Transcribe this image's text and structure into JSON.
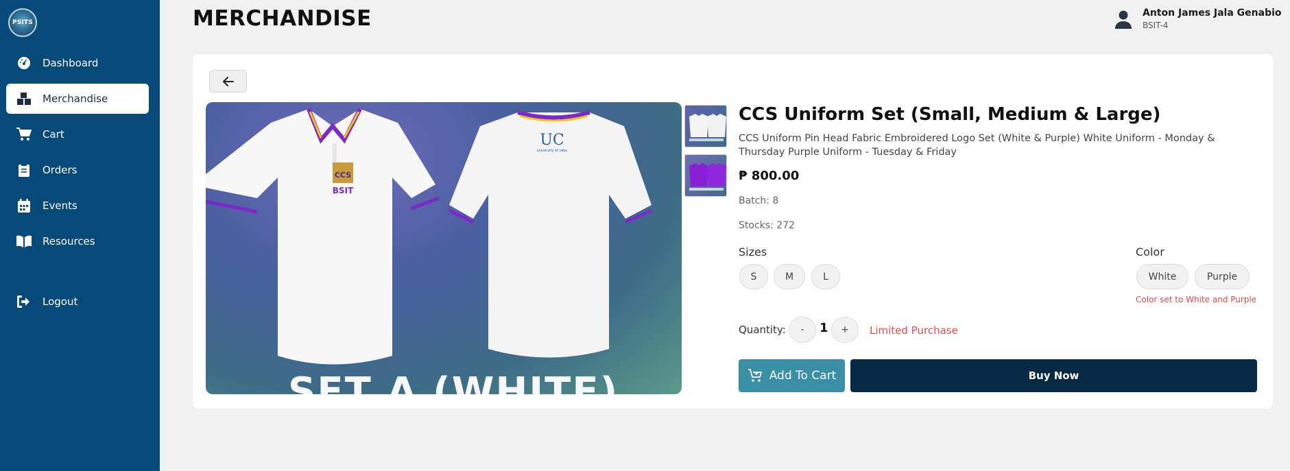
{
  "app": {
    "logo_text": "PSITS"
  },
  "sidebar": {
    "items": [
      {
        "label": "Dashboard",
        "icon": "dashboard-gauge-icon",
        "active": false
      },
      {
        "label": "Merchandise",
        "icon": "boxes-icon",
        "active": true
      },
      {
        "label": "Cart",
        "icon": "cart-icon",
        "active": false
      },
      {
        "label": "Orders",
        "icon": "clipboard-icon",
        "active": false
      },
      {
        "label": "Events",
        "icon": "calendar-icon",
        "active": false
      },
      {
        "label": "Resources",
        "icon": "book-icon",
        "active": false
      },
      {
        "label": "Logout",
        "icon": "logout-icon",
        "active": false
      }
    ]
  },
  "header": {
    "title": "MERCHANDISE",
    "user": {
      "name": "Anton James Jala Genabio",
      "sub": "BSIT-4",
      "icon": "user-icon"
    }
  },
  "product": {
    "image_caption": "SET A (WHITE)",
    "title": "CCS Uniform Set (Small, Medium & Large)",
    "description": "CCS Uniform Pin Head Fabric Embroidered Logo Set (White & Purple) White Uniform - Monday & Thursday Purple Uniform - Tuesday & Friday",
    "price": "₱ 800.00",
    "batch": "Batch: 8",
    "stocks": "Stocks: 272",
    "sizes_label": "Sizes",
    "sizes": [
      "S",
      "M",
      "L"
    ],
    "color_label": "Color",
    "colors": [
      "White",
      "Purple"
    ],
    "color_note": "Color set to White and Purple",
    "quantity_label": "Quantity:",
    "quantity": "1",
    "minus": "-",
    "plus": "+",
    "limited": "Limited Purchase",
    "add_to_cart": "Add To Cart",
    "buy_now": "Buy Now"
  },
  "colors": {
    "sidebar": "#074979",
    "add_to_cart": "#3a8fa7",
    "buy_now": "#072a44",
    "warning": "#e24a4a"
  }
}
